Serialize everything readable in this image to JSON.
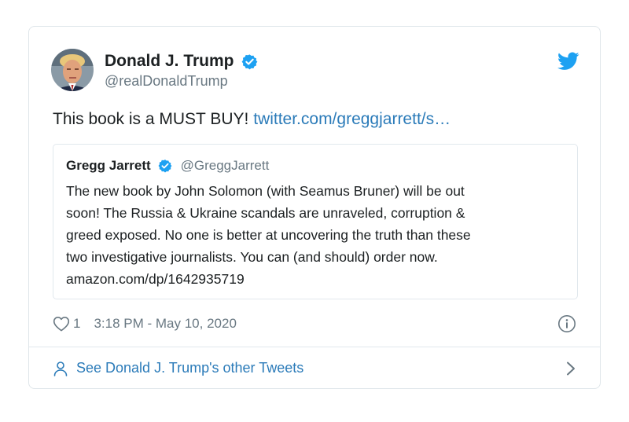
{
  "author": {
    "display_name": "Donald J. Trump",
    "handle": "@realDonaldTrump",
    "verified": true,
    "avatar_icon": "avatar-photo"
  },
  "tweet": {
    "text_prefix": "This book is a MUST BUY!",
    "link_text": "twitter.com/greggjarrett/s…"
  },
  "quoted_tweet": {
    "display_name": "Gregg Jarrett",
    "handle": "@GreggJarrett",
    "verified": true,
    "body_lines": [
      "The new book by John Solomon (with Seamus Bruner) will be out",
      "soon! The Russia & Ukraine scandals are unraveled, corruption &",
      "greed exposed. No one is better at uncovering the truth than these",
      "two investigative journalists. You can (and should) order now.",
      "amazon.com/dp/1642935719"
    ]
  },
  "meta": {
    "like_count": "1",
    "timestamp": "3:18 PM - May 10, 2020"
  },
  "footer": {
    "link_text": "See Donald J. Trump's other Tweets"
  },
  "icons": {
    "brand": "twitter-bird-icon",
    "like": "heart-icon",
    "info": "info-icon",
    "profile": "person-icon",
    "more": "chevron-right-icon"
  },
  "colors": {
    "link": "#2b7bb9",
    "verified": "#1da1f2",
    "muted": "#697882",
    "text": "#1c2022",
    "border": "#e1e8ed"
  }
}
